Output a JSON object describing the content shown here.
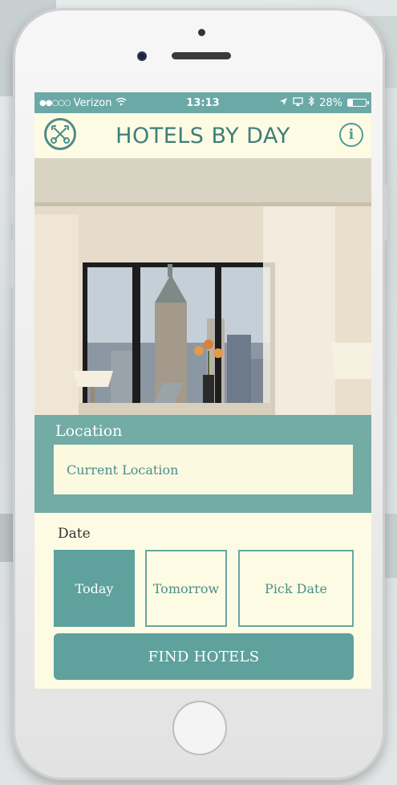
{
  "status_bar": {
    "signal": "●●○○○",
    "carrier": "Verizon",
    "time": "13:13",
    "battery": "28%",
    "battery_level": 0.28
  },
  "header": {
    "title": "HOTELS BY DAY",
    "info_glyph": "i",
    "logo_icon": "crossed-keys-icon"
  },
  "location": {
    "label": "Location",
    "value": "Current Location"
  },
  "date": {
    "label": "Date",
    "options": [
      "Today",
      "Tomorrow",
      "Pick Date"
    ],
    "selected": "Today"
  },
  "find_button": "FIND HOTELS",
  "colors": {
    "teal": "#5ea19d",
    "cream": "#fdfbe3",
    "title": "#3e7e7b"
  }
}
